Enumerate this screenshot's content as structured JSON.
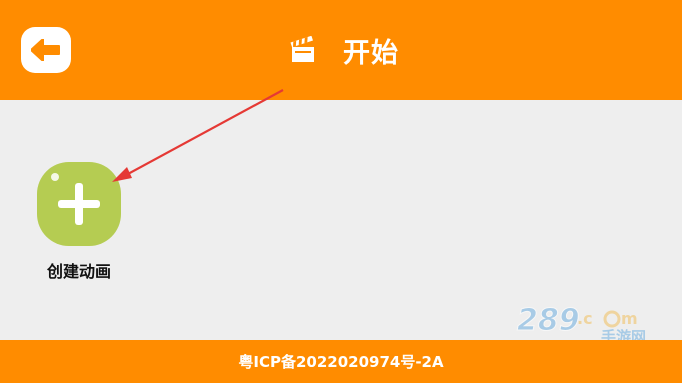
{
  "header": {
    "back_icon": "back-arrow-icon",
    "title_icon": "clapperboard-icon",
    "title": "开始"
  },
  "main": {
    "create_button": {
      "icon": "plus-icon",
      "label": "创建动画"
    }
  },
  "watermark": {
    "text": "289.com 手游网"
  },
  "footer": {
    "icp": "粤ICP备2022020974号-2A"
  },
  "colors": {
    "header_bg": "#ff8c00",
    "content_bg": "#eeeeee",
    "create_button_bg": "#b5cc52",
    "annotation_arrow": "#e53935"
  }
}
